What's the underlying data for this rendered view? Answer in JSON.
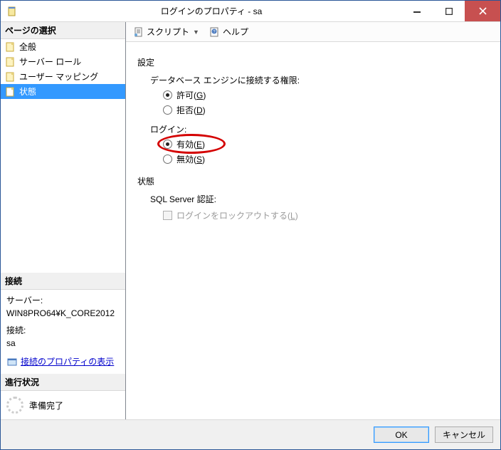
{
  "window": {
    "title": "ログインのプロパティ - sa"
  },
  "sidebar": {
    "page_select_header": "ページの選択",
    "items": [
      {
        "label": "全般"
      },
      {
        "label": "サーバー ロール"
      },
      {
        "label": "ユーザー マッピング"
      },
      {
        "label": "状態"
      }
    ],
    "selected_index": 3,
    "connection_header": "接続",
    "server_label": "サーバー:",
    "server_value": "WIN8PRO64¥K_CORE2012",
    "connection_label": "接続:",
    "connection_value": "sa",
    "view_conn_props": "接続のプロパティの表示",
    "progress_header": "進行状況",
    "progress_status": "準備完了"
  },
  "toolbar": {
    "script_label": "スクリプト",
    "help_label": "ヘルプ"
  },
  "main": {
    "settings_label": "設定",
    "db_engine_perm_label": "データベース エンジンに接続する権限:",
    "grant_prefix": "許可(",
    "grant_key": "G",
    "grant_suffix": ")",
    "deny_prefix": "拒否(",
    "deny_key": "D",
    "deny_suffix": ")",
    "login_label": "ログイン:",
    "enable_prefix": "有効(",
    "enable_key": "E",
    "enable_suffix": ")",
    "disable_prefix": "無効(",
    "disable_key": "S",
    "disable_suffix": ")",
    "status_label": "状態",
    "sql_auth_label": "SQL Server 認証:",
    "lockout_prefix": "ログインをロックアウトする(",
    "lockout_key": "L",
    "lockout_suffix": ")"
  },
  "footer": {
    "ok_label": "OK",
    "cancel_label": "キャンセル"
  }
}
